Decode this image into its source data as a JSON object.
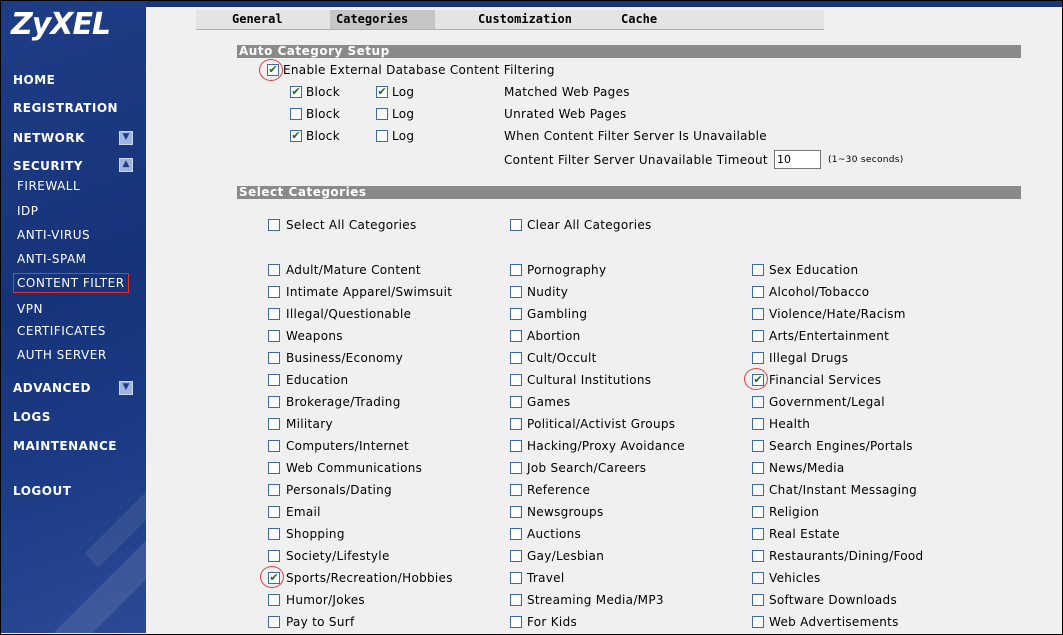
{
  "brand": {
    "logo": "ZyXEL"
  },
  "nav": {
    "home": "HOME",
    "registration": "REGISTRATION",
    "network": "NETWORK",
    "security": "SECURITY",
    "security_items": [
      "FIREWALL",
      "IDP",
      "ANTI-VIRUS",
      "ANTI-SPAM",
      "CONTENT FILTER",
      "VPN",
      "CERTIFICATES",
      "AUTH SERVER"
    ],
    "advanced": "ADVANCED",
    "logs": "LOGS",
    "maintenance": "MAINTENANCE",
    "logout": "LOGOUT",
    "active_item": "CONTENT FILTER"
  },
  "tabs": [
    "General",
    "Categories",
    "Customization",
    "Cache"
  ],
  "active_tab": "Categories",
  "auto_setup": {
    "title": "Auto Category Setup",
    "enable_label": "Enable External Database Content Filtering",
    "enable_checked": true,
    "block_label": "Block",
    "log_label": "Log",
    "rows": [
      {
        "block": true,
        "log": true,
        "desc": "Matched Web Pages"
      },
      {
        "block": false,
        "log": false,
        "desc": "Unrated Web Pages"
      },
      {
        "block": true,
        "log": false,
        "desc": "When Content Filter Server Is Unavailable"
      }
    ],
    "timeout_label": "Content Filter Server Unavailable Timeout",
    "timeout_value": "10",
    "timeout_hint": "(1~30 seconds)"
  },
  "select_categories": {
    "title": "Select Categories",
    "select_all": "Select All Categories",
    "clear_all": "Clear All Categories",
    "col1": [
      "Adult/Mature Content",
      "Intimate Apparel/Swimsuit",
      "Illegal/Questionable",
      "Weapons",
      "Business/Economy",
      "Education",
      "Brokerage/Trading",
      "Military",
      "Computers/Internet",
      "Web Communications",
      "Personals/Dating",
      "Email",
      "Shopping",
      "Society/Lifestyle",
      "Sports/Recreation/Hobbies",
      "Humor/Jokes",
      "Pay to Surf"
    ],
    "col2": [
      "Pornography",
      "Nudity",
      "Gambling",
      "Abortion",
      "Cult/Occult",
      "Cultural Institutions",
      "Games",
      "Political/Activist Groups",
      "Hacking/Proxy Avoidance",
      "Job Search/Careers",
      "Reference",
      "Newsgroups",
      "Auctions",
      "Gay/Lesbian",
      "Travel",
      "Streaming Media/MP3",
      "For Kids"
    ],
    "col3": [
      "Sex Education",
      "Alcohol/Tobacco",
      "Violence/Hate/Racism",
      "Arts/Entertainment",
      "Illegal Drugs",
      "Financial Services",
      "Government/Legal",
      "Health",
      "Search Engines/Portals",
      "News/Media",
      "Chat/Instant Messaging",
      "Religion",
      "Real Estate",
      "Restaurants/Dining/Food",
      "Vehicles",
      "Software Downloads",
      "Web Advertisements"
    ],
    "checked": [
      "Sports/Recreation/Hobbies",
      "Financial Services"
    ]
  },
  "colors": {
    "sidebar": "#1f3d86",
    "section_bar": "#8a8a8a",
    "highlight": "#e04040"
  }
}
